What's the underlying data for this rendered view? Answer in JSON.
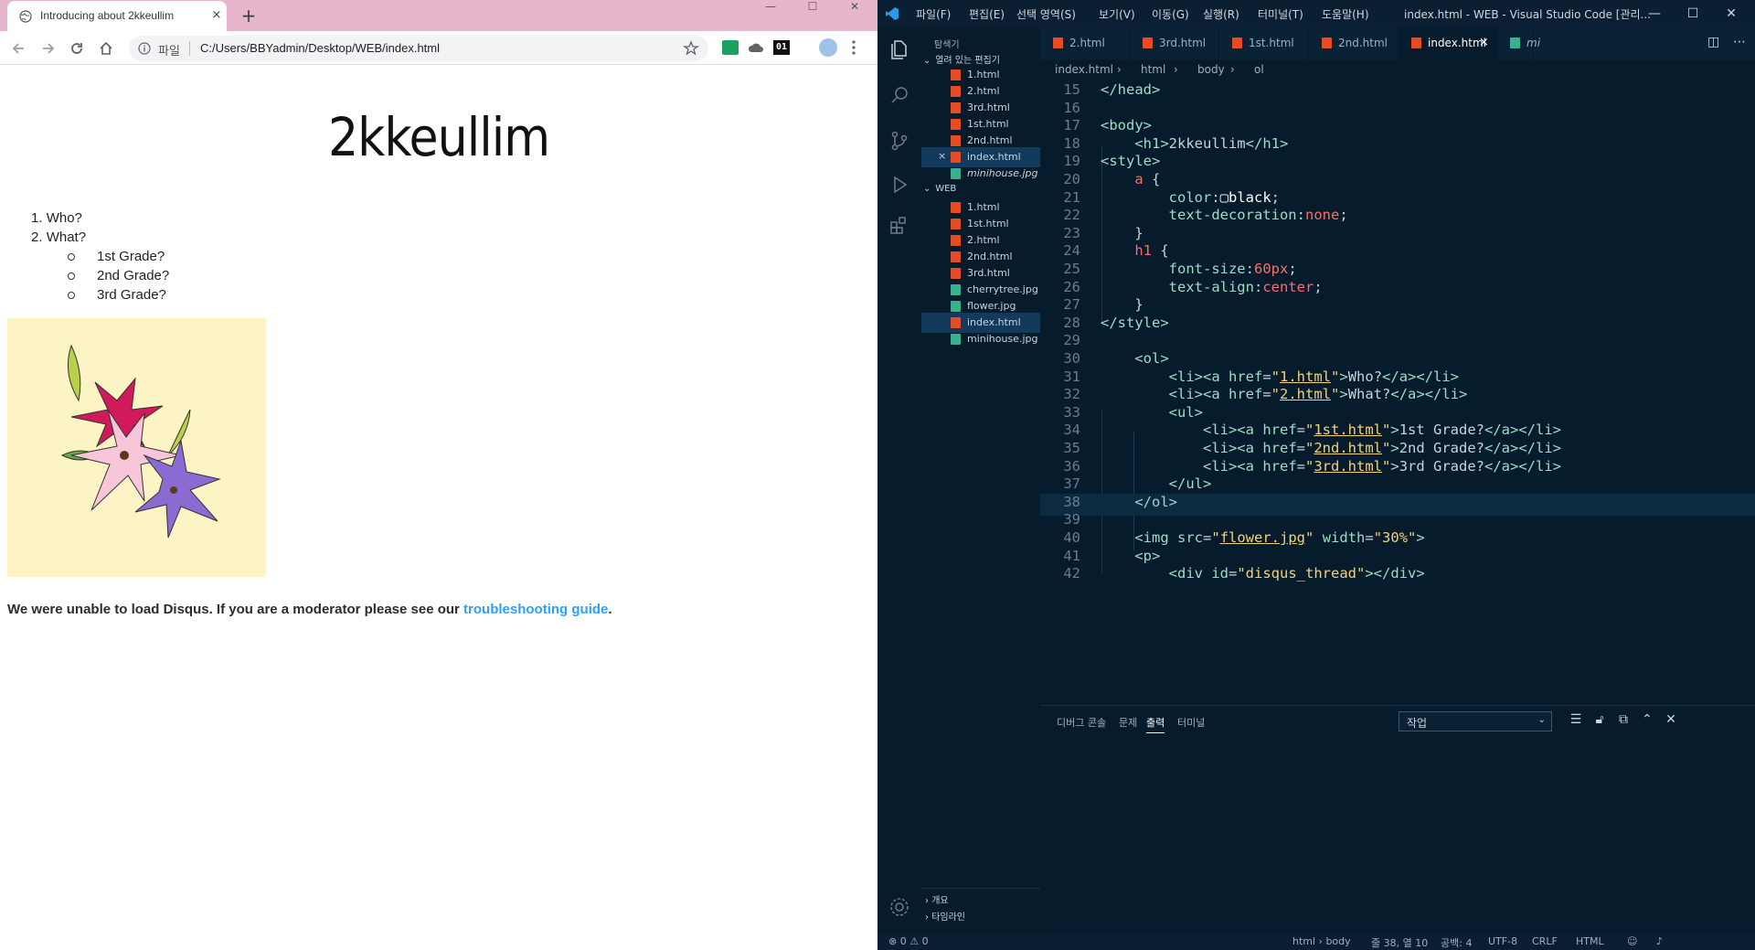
{
  "browser": {
    "tab_title": "Introducing about 2kkeullim",
    "tab_close": "×",
    "new_tab": "+",
    "window_minimize": "—",
    "window_maximize": "☐",
    "window_close": "✕",
    "url_scheme": "파일",
    "url": "C:/Users/BBYadmin/Desktop/WEB/index.html",
    "ext_badge": "01",
    "page": {
      "heading": "2kkeullim",
      "list": [
        {
          "num": "1.",
          "label": "Who?"
        },
        {
          "num": "2.",
          "label": "What?"
        }
      ],
      "sublist": [
        "1st Grade?",
        "2nd Grade?",
        "3rd Grade?"
      ],
      "disqus_text": "We were unable to load Disqus. If you are a moderator please see our ",
      "disqus_link": "troubleshooting guide",
      "disqus_end": "."
    }
  },
  "vscode": {
    "menu": [
      "파일(F)",
      "편집(E)",
      "선택 영역(S)",
      "보기(V)",
      "이동(G)",
      "실행(R)",
      "터미널(T)",
      "도움말(H)"
    ],
    "window_title": "index.html - WEB - Visual Studio Code [관리...",
    "explorer_title": "탐색기",
    "open_editors_label": "열려 있는 편집기",
    "open_editors": [
      {
        "name": "1.html",
        "type": "html"
      },
      {
        "name": "2.html",
        "type": "html"
      },
      {
        "name": "3rd.html",
        "type": "html"
      },
      {
        "name": "1st.html",
        "type": "html"
      },
      {
        "name": "2nd.html",
        "type": "html"
      },
      {
        "name": "index.html",
        "type": "html",
        "selected": true,
        "close": "×"
      },
      {
        "name": "minihouse.jpg",
        "type": "img",
        "italic": true
      }
    ],
    "workspace_label": "WEB",
    "workspace_files": [
      {
        "name": "1.html",
        "type": "html"
      },
      {
        "name": "1st.html",
        "type": "html"
      },
      {
        "name": "2.html",
        "type": "html"
      },
      {
        "name": "2nd.html",
        "type": "html"
      },
      {
        "name": "3rd.html",
        "type": "html"
      },
      {
        "name": "cherrytree.jpg",
        "type": "img"
      },
      {
        "name": "flower.jpg",
        "type": "img"
      },
      {
        "name": "index.html",
        "type": "html",
        "selected": true
      },
      {
        "name": "minihouse.jpg",
        "type": "img"
      }
    ],
    "editor_tabs": [
      {
        "name": "2.html"
      },
      {
        "name": "3rd.html"
      },
      {
        "name": "1st.html"
      },
      {
        "name": "2nd.html"
      },
      {
        "name": "index.html",
        "active": true,
        "close": "×"
      },
      {
        "name": "mi"
      }
    ],
    "breadcrumbs": [
      "index.html",
      "html",
      "body",
      "ol"
    ],
    "code_lines": [
      {
        "n": "15",
        "html": "<span class='t-tag'>&lt;/head&gt;</span>"
      },
      {
        "n": "16",
        "html": ""
      },
      {
        "n": "17",
        "html": "<span class='t-tag'>&lt;body&gt;</span>"
      },
      {
        "n": "18",
        "html": "    <span class='t-tag'>&lt;h1&gt;</span>2kkeullim<span class='t-tag'>&lt;/h1&gt;</span>"
      },
      {
        "n": "19",
        "html": "<span class='t-tag'>&lt;style&gt;</span>"
      },
      {
        "n": "20",
        "html": "    <span class='t-sel'>a</span> {"
      },
      {
        "n": "21",
        "html": "        <span class='t-prop'>color</span>:<span class='t-val'>▢black</span>;"
      },
      {
        "n": "22",
        "html": "        <span class='t-prop'>text-decoration</span>:<span class='t-kw'>none</span>;"
      },
      {
        "n": "23",
        "html": "    }"
      },
      {
        "n": "24",
        "html": "    <span class='t-sel'>h1</span> {"
      },
      {
        "n": "25",
        "html": "        <span class='t-prop'>font-size</span>:<span class='t-num'>60</span><span class='t-kw'>px</span>;"
      },
      {
        "n": "26",
        "html": "        <span class='t-prop'>text-align</span>:<span class='t-kw'>center</span>;"
      },
      {
        "n": "27",
        "html": "    }"
      },
      {
        "n": "28",
        "html": "<span class='t-tag'>&lt;/style&gt;</span>"
      },
      {
        "n": "29",
        "html": ""
      },
      {
        "n": "30",
        "html": "    <span class='t-tag'>&lt;ol&gt;</span>"
      },
      {
        "n": "31",
        "html": "        <span class='t-tag'>&lt;li&gt;&lt;a</span> <span class='t-attr'>href</span>=<span class='t-str'>\"<span class='t-link'>1.html</span>\"</span><span class='t-tag'>&gt;</span>Who?<span class='t-tag'>&lt;/a&gt;&lt;/li&gt;</span>"
      },
      {
        "n": "32",
        "html": "        <span class='t-tag'>&lt;li&gt;&lt;a</span> <span class='t-attr'>href</span>=<span class='t-str'>\"<span class='t-link'>2.html</span>\"</span><span class='t-tag'>&gt;</span>What?<span class='t-tag'>&lt;/a&gt;&lt;/li&gt;</span>"
      },
      {
        "n": "33",
        "html": "        <span class='t-tag'>&lt;ul&gt;</span>"
      },
      {
        "n": "34",
        "html": "            <span class='t-tag'>&lt;li&gt;&lt;a</span> <span class='t-attr'>href</span>=<span class='t-str'>\"<span class='t-link'>1st.html</span>\"</span><span class='t-tag'>&gt;</span>1st Grade?<span class='t-tag'>&lt;/a&gt;&lt;/li&gt;</span>"
      },
      {
        "n": "35",
        "html": "            <span class='t-tag'>&lt;li&gt;&lt;a</span> <span class='t-attr'>href</span>=<span class='t-str'>\"<span class='t-link'>2nd.html</span>\"</span><span class='t-tag'>&gt;</span>2nd Grade?<span class='t-tag'>&lt;/a&gt;&lt;/li&gt;</span>"
      },
      {
        "n": "36",
        "html": "            <span class='t-tag'>&lt;li&gt;&lt;a</span> <span class='t-attr'>href</span>=<span class='t-str'>\"<span class='t-link'>3rd.html</span>\"</span><span class='t-tag'>&gt;</span>3rd Grade?<span class='t-tag'>&lt;/a&gt;&lt;/li&gt;</span>"
      },
      {
        "n": "37",
        "html": "        <span class='t-tag'>&lt;/ul&gt;</span>"
      },
      {
        "n": "38",
        "html": "    <span class='t-tag'>&lt;/ol&gt;</span>",
        "current": true
      },
      {
        "n": "39",
        "html": ""
      },
      {
        "n": "40",
        "html": "    <span class='t-tag'>&lt;img</span> <span class='t-attr'>src</span>=<span class='t-str'>\"<span class='t-link'>flower.jpg</span>\"</span> <span class='t-attr'>width</span>=<span class='t-str'>\"30%\"</span><span class='t-tag'>&gt;</span>"
      },
      {
        "n": "41",
        "html": "    <span class='t-tag'>&lt;p&gt;</span>"
      },
      {
        "n": "42",
        "html": "        <span class='t-tag'>&lt;div</span> <span class='t-attr'>id</span>=<span class='t-str'>\"disqus_thread\"</span><span class='t-tag'>&gt;&lt;/div&gt;</span>"
      }
    ],
    "panel_tabs": [
      "디버그 콘솔",
      "문제",
      "출력",
      "터미널"
    ],
    "panel_active": "출력",
    "panel_select": "작업",
    "outline_sections": [
      "개요",
      "타임라인"
    ],
    "status": {
      "errors": "⊗ 0 ⚠ 0",
      "crumb": "html › body",
      "position": "줄 38, 열 10",
      "spaces": "공백: 4",
      "encoding": "UTF-8",
      "eol": "CRLF",
      "language": "HTML"
    },
    "colors": {
      "background": "#061c2c",
      "tag": "#9edcc7",
      "string": "#f2d27a",
      "keyword": "#ff6a6a"
    }
  }
}
